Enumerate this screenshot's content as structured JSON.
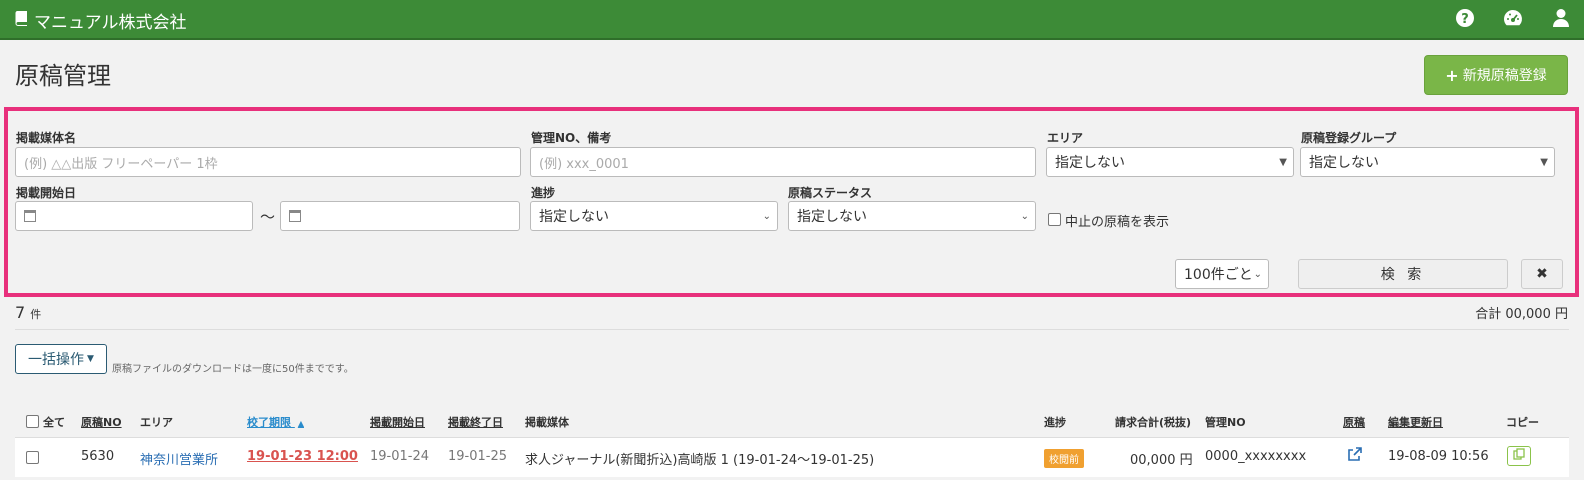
{
  "header": {
    "brand": "マニュアル株式会社",
    "icons": [
      "book-icon",
      "help-icon",
      "dashboard-icon",
      "user-icon"
    ]
  },
  "page": {
    "title": "原稿管理",
    "new_button": "新規原稿登録"
  },
  "search": {
    "media_label": "掲載媒体名",
    "media_placeholder": "(例) △△出版 フリーペーパー 1枠",
    "mgmt_label": "管理NO、備考",
    "mgmt_placeholder": "(例) xxx_0001",
    "area_label": "エリア",
    "area_value": "指定しない",
    "group_label": "原稿登録グループ",
    "group_value": "指定しない",
    "start_label": "掲載開始日",
    "tilde": "〜",
    "progress_label": "進捗",
    "progress_value": "指定しない",
    "status_label": "原稿ステータス",
    "status_value": "指定しない",
    "canceled_label": "中止の原稿を表示",
    "per_page": "100件ごと",
    "search_button": "検 索",
    "clear_button": "✖"
  },
  "results": {
    "count": "7",
    "count_unit": "件",
    "total": "合計 00,000 円",
    "bulk_button": "一括操作",
    "note": "原稿ファイルのダウンロードは一度に50件までです。"
  },
  "table": {
    "headers": {
      "all": "全て",
      "no": "原稿NO",
      "area": "エリア",
      "deadline": "校了期限",
      "start": "掲載開始日",
      "end": "掲載終了日",
      "media": "掲載媒体",
      "progress": "進捗",
      "billing": "請求合計(税抜)",
      "mgmt": "管理NO",
      "manuscript": "原稿",
      "updated": "編集更新日",
      "copy": "コピー"
    },
    "rows": [
      {
        "no": "5630",
        "area": "神奈川営業所",
        "deadline": "19-01-23 12:00",
        "start": "19-01-24",
        "end": "19-01-25",
        "media": "求人ジャーナル(新聞折込)高崎版 1 (19-01-24〜19-01-25)",
        "progress": "校閲前",
        "billing": "00,000 円",
        "mgmt": "0000_xxxxxxxx",
        "updated": "19-08-09 10:56"
      }
    ]
  },
  "colors": {
    "header": "#3d8b37",
    "new_button": "#7ab648",
    "highlight": "#e8307c",
    "link": "#2a6eb3",
    "deadline": "#d9534f",
    "badge": "#f0a030"
  }
}
